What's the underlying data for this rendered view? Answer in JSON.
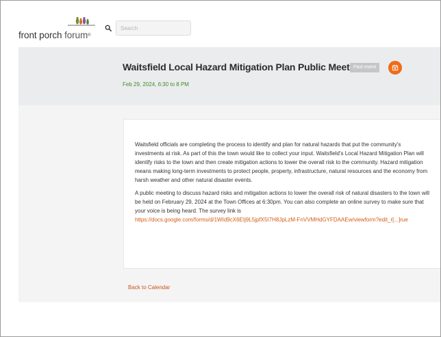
{
  "header": {
    "logo": {
      "name_bold": "front porch",
      "name_light": "forum",
      "registered_mark": "®"
    },
    "search": {
      "placeholder": "Search",
      "icon": "search-icon"
    }
  },
  "event": {
    "title": "Waitsfield Local Hazard Mitigation Plan Public Meeting",
    "badge": "Past event",
    "calendar_icon": "calendar-add-icon",
    "date": "Feb 29, 2024, 6:30 to 8 PM"
  },
  "description": {
    "paragraph1": "Waitsfield officials are completing the process to identify and plan for natural hazards that put the community's investments at risk. As part of this the town would like to collect your input. Waitsfield's Local Hazard Mitigation Plan will identify risks to the town and then create mitigation actions to lower the overall risk to the community. Hazard mitigation means making long-term investments to protect people, property, infrastructure, natural resources and the economy from harsh weather and other natural disaster events.",
    "paragraph2": "A public meeting to discuss hazard risks and mitigation actions to lower the overall risk of natural disasters to the town will be held on February 29, 2024 at the Town Offices at 6:30pm. You can also complete an online survey to make sure that your voice is being heard. The survey link is",
    "survey_link": "https://docs.google.com/forms/d/1WId9cX6EIj9L5jpfX5I7H8JpLzM-FnVVMHdGYFDAAEw/viewform?edit_r[...]rue"
  },
  "footer": {
    "back_link": "Back to Calendar"
  },
  "colors": {
    "accent_orange": "#ef6c1a",
    "date_green": "#3f8a2b",
    "link_orange": "#d45a14",
    "badge_gray": "#c5c6c8"
  }
}
